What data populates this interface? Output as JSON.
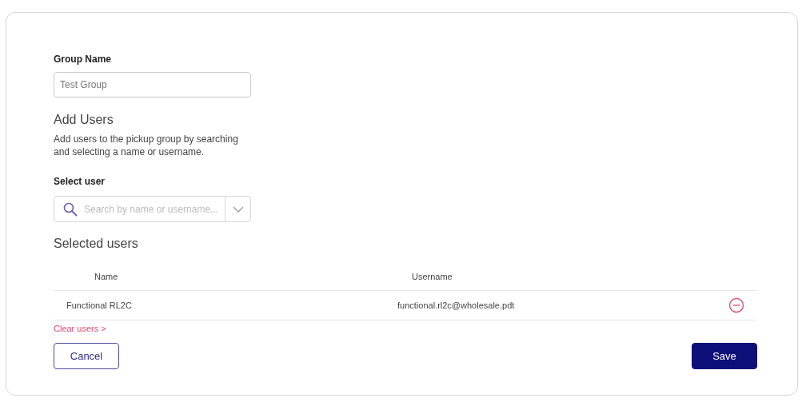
{
  "group_name": {
    "label": "Group Name",
    "value": "Test Group"
  },
  "add_users": {
    "title": "Add Users",
    "description": "Add users to the pickup group by searching and selecting a name or username."
  },
  "select_user": {
    "label": "Select user",
    "placeholder": "Search by name or username..."
  },
  "selected_users": {
    "title": "Selected users",
    "columns": [
      "Name",
      "Username"
    ],
    "rows": [
      {
        "name": "Functional RL2C",
        "username": "functional.rl2c@wholesale.pdt"
      }
    ]
  },
  "clear_link": "Clear users >",
  "buttons": [
    {
      "kind": "secondary",
      "label": "Cancel"
    },
    {
      "kind": "primary",
      "label": "Save"
    }
  ]
}
